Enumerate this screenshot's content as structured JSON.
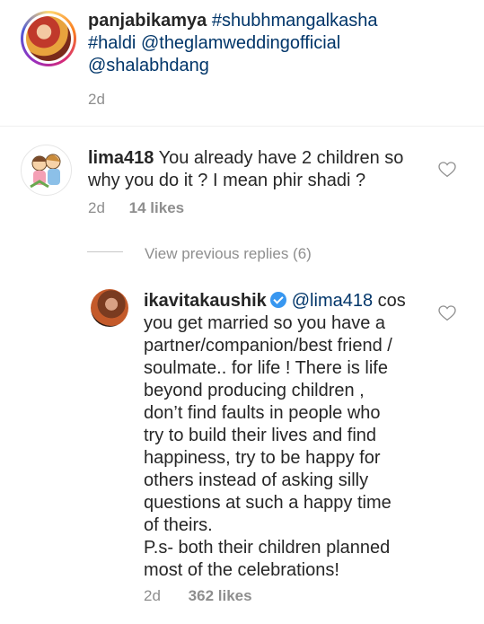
{
  "post": {
    "username": "panjabikamya",
    "caption_line1": "#shubhmangalkasha",
    "caption_line2_tag": "#haldi",
    "caption_line2_mention": "@theglamweddingofficial",
    "caption_line3": "@shalabhdang",
    "time": "2d"
  },
  "comment": {
    "username": "lima418",
    "text_line1": "You already have 2 children so",
    "text_line2": "why you do it ? I mean phir shadi ?",
    "time": "2d",
    "likes": "14 likes"
  },
  "view_replies": "View previous replies (6)",
  "reply": {
    "username": "ikavitakaushik",
    "mention": "@lima418",
    "first_text": "cos",
    "lines": [
      "you get married so you have a",
      "partner/companion/best friend /",
      "soulmate.. for life ! There is life",
      "beyond producing children ,",
      "don’t find faults in people who",
      "try to build their lives and find",
      "happiness, try to be happy for",
      "others instead of asking silly",
      "questions at such a happy time",
      "of theirs.",
      "P.s- both their children planned",
      "most of the celebrations!"
    ],
    "time": "2d",
    "likes": "362 likes"
  },
  "colors": {
    "link": "#003569",
    "muted": "#8e8e8e",
    "verified": "#3897f0"
  },
  "icons": [
    "heart-outline-icon",
    "verified-badge-icon"
  ]
}
